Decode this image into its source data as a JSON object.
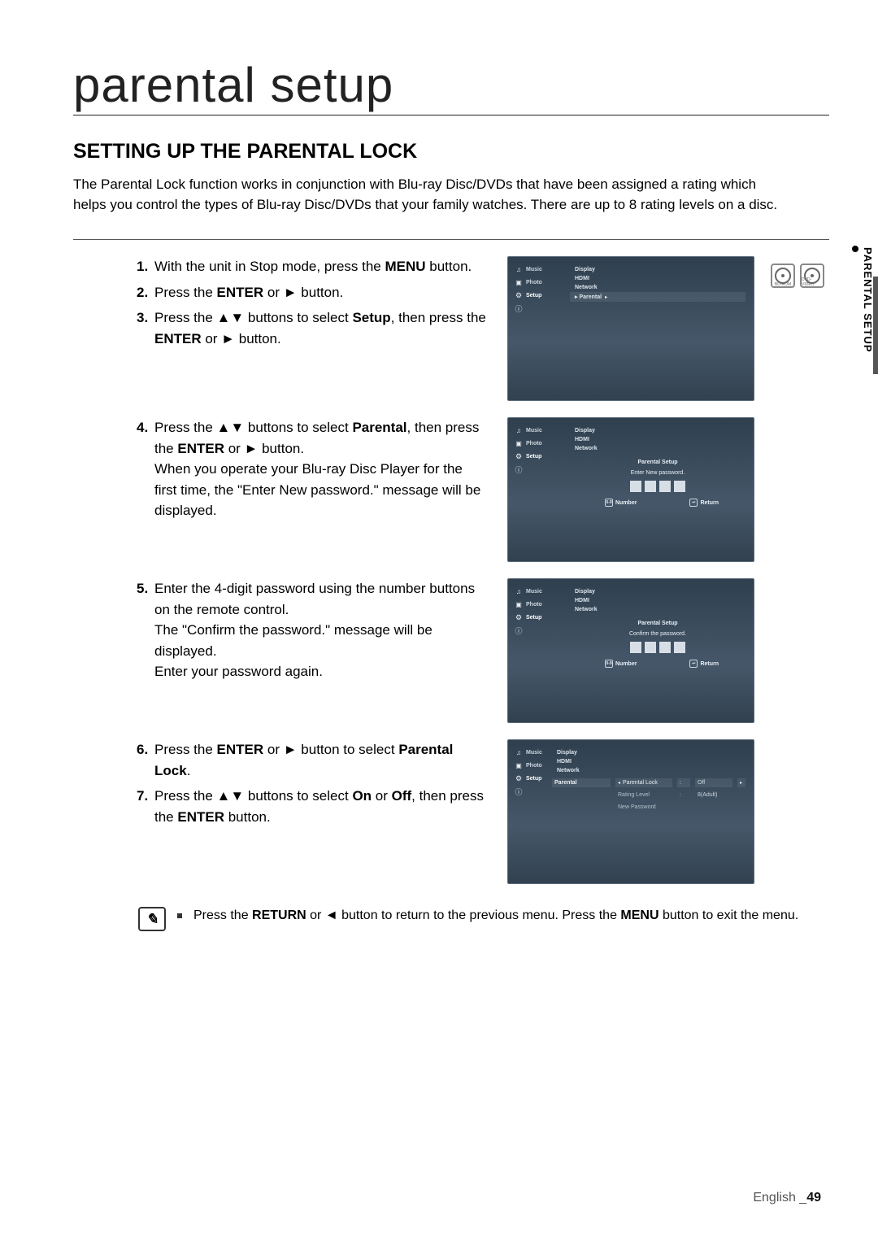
{
  "page": {
    "chapter_title": "parental setup",
    "section_title": "SETTING UP THE PARENTAL LOCK",
    "intro": "The Parental Lock function works in conjunction with Blu-ray Disc/DVDs that have been assigned a rating which helps you control the types of Blu-ray Disc/DVDs that your family watches. There are up to 8 rating levels on a disc.",
    "side_label": "PARENTAL SETUP",
    "disc_labels": {
      "bd": "BD-ROM",
      "dvd": "DVD-VIDEO"
    },
    "footer": {
      "lang": "English",
      "sep": "_",
      "page": "49"
    }
  },
  "steps": {
    "s1": {
      "num": "1.",
      "text": "With the unit in Stop mode, press the ",
      "b1": "MENU",
      "tail": " button."
    },
    "s2": {
      "num": "2.",
      "pre": "Press the ",
      "b1": "ENTER",
      "mid": " or ► button."
    },
    "s3": {
      "num": "3.",
      "pre": "Press the ▲▼ buttons to select ",
      "b1": "Setup",
      "mid": ", then press the ",
      "b2": "ENTER",
      "tail": " or ► button."
    },
    "s4": {
      "num": "4.",
      "pre": "Press the ▲▼ buttons to select ",
      "b1": "Parental",
      "mid": ", then press the ",
      "b2": "ENTER",
      "tail": " or ► button.",
      "extra": "When you operate your Blu-ray Disc Player for the first time, the \"Enter New password.\" message will be displayed."
    },
    "s5": {
      "num": "5.",
      "text": "Enter the 4-digit password using the number buttons on the remote control.",
      "extra1": "The \"Confirm the password.\" message will be displayed.",
      "extra2": "Enter your password again."
    },
    "s6": {
      "num": "6.",
      "pre": "Press the ",
      "b1": "ENTER",
      "mid": " or ► button to select ",
      "b2": "Parental Lock",
      "tail": "."
    },
    "s7": {
      "num": "7.",
      "pre": "Press the ▲▼ buttons to select ",
      "b1": "On",
      "mid": " or ",
      "b2": "Off",
      "mid2": ", then press the ",
      "b3": "ENTER",
      "tail": " button."
    }
  },
  "tv": {
    "nav": {
      "music": "Music",
      "photo": "Photo",
      "setup": "Setup"
    },
    "menu": {
      "display": "Display",
      "hdmi": "HDMI",
      "network": "Network",
      "parental": "Parental",
      "parental_bullet": "▸ Parental"
    },
    "dialog": {
      "title": "Parental Setup",
      "msg_enter": "Enter New password.",
      "msg_confirm": "Confirm the password.",
      "hint_number": "Number",
      "hint_return": "Return"
    },
    "lock": {
      "col_parental": "Parental",
      "parental_lock": "Parental Lock",
      "rating_level": "Rating Level",
      "new_password": "New Password",
      "off": "Off",
      "rating_val": "8(Adult)",
      "colon": ":",
      "caret_l": "◂",
      "caret_r": "▸"
    }
  },
  "note": {
    "text_pre": "Press the ",
    "b1": "RETURN",
    "mid1": " or ◄ button to return to the previous menu. Press the ",
    "b2": "MENU",
    "tail": " button to exit the menu."
  }
}
